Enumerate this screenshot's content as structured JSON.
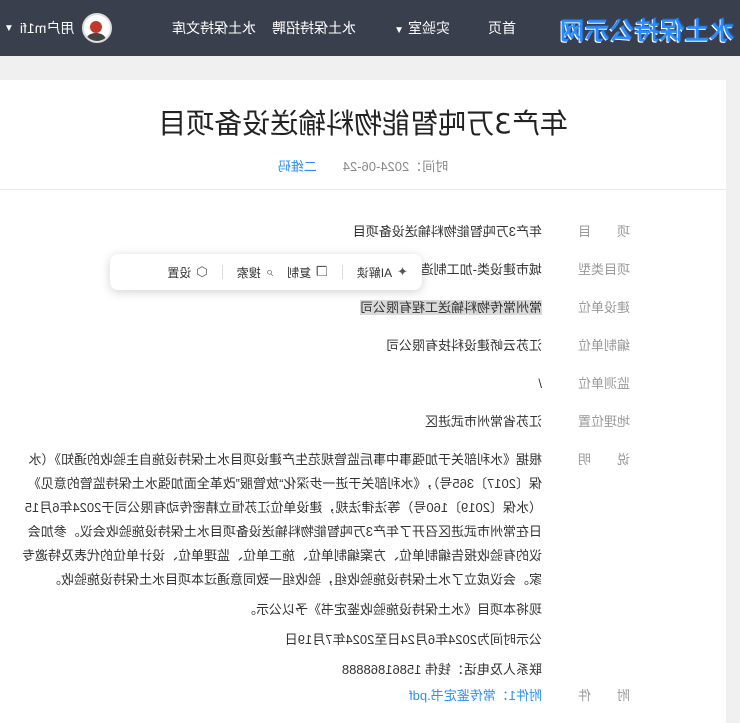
{
  "nav": {
    "logo": "水土保持公示网",
    "items": [
      {
        "label": "首页"
      },
      {
        "label": "实验室",
        "has_dropdown": true
      },
      {
        "label": "水土保持招聘"
      },
      {
        "label": "水土保持文库"
      }
    ],
    "user_label": "用户m1fi"
  },
  "article": {
    "title": "年产3万吨智能物料输送设备项目",
    "meta_time": "时间：2024-06-24",
    "qr_label": "二维码"
  },
  "toolbar": {
    "ai_label": "AI解读",
    "copy_label": "复制",
    "search_label": "搜索",
    "settings_label": "设置"
  },
  "fields": [
    {
      "label": "项　　目",
      "value": "年产3万吨智能物料输送设备项目"
    },
    {
      "label": "项目类型",
      "value": "城市建设类-加工制造类项目"
    },
    {
      "label": "建设单位",
      "value": "常州常传物料输送工程有限公司"
    },
    {
      "label": "编制单位",
      "value": "江苏云峤建设科技有限公司"
    },
    {
      "label": "监测单位",
      "value": "/"
    },
    {
      "label": "地理位置",
      "value": "江苏省常州市武进区"
    }
  ],
  "description": {
    "label": "说　　明",
    "paragraphs": [
      "根据《水利部关于加强事中事后监管规范生产建设项目水土保持设施自主验收的通知》（水保〔2017〕365号），《水利部关于进一步深化“放管服”改革全面加强水土保持监管的意见》（水保〔2019〕160号）等法律法规，建设单位江苏恒立精密传动有限公司于2024年6月15日在常州市武进区召开了年产3万吨智能物料输送设备项目水土保持设施验收会议。参加会议的有验收报告编制单位、方案编制单位、施工单位、监理单位、设计单位的代表及特邀专家。会议成立了水土保持设施验收组，验收组一致同意通过本项目水土保持设施验收。",
      "现将本项目《水土保持设施验收鉴定书》予以公示。",
      "公示时间为2024年6月24日至2024年7月19日",
      "联系人及电话：钱伟 15861868888"
    ]
  },
  "attachment": {
    "label": "附　　件",
    "link": "附件1：常传鉴定书.pdf"
  }
}
